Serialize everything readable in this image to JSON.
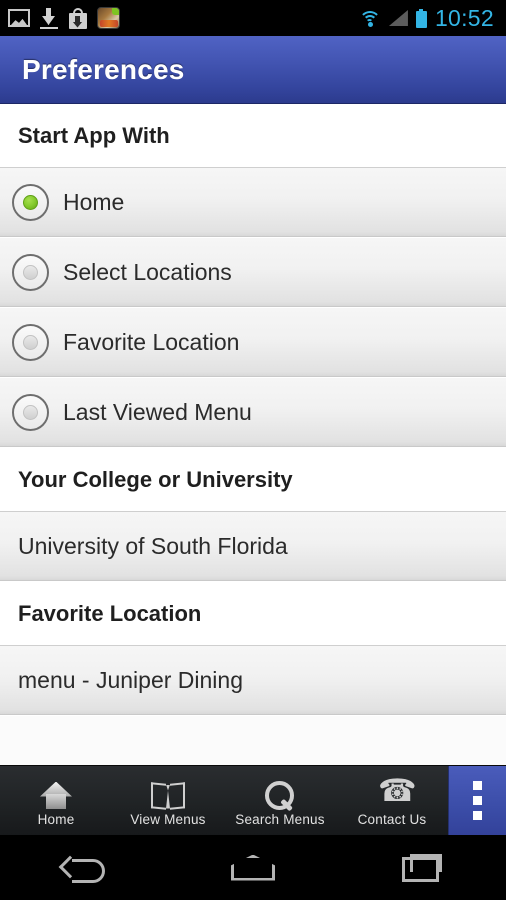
{
  "status_bar": {
    "time": "10:52",
    "notification_icons": [
      "image-icon",
      "download-icon",
      "play-store-bag-icon",
      "app-thumbnail-icon"
    ],
    "system_icons": [
      "wifi-icon",
      "cell-signal-icon",
      "battery-icon"
    ],
    "accent_color": "#33b5e5"
  },
  "title_bar": {
    "title": "Preferences",
    "background_color": "#4456b4"
  },
  "sections": [
    {
      "header": "Start App With",
      "type": "radio-group",
      "options": [
        {
          "label": "Home",
          "selected": true
        },
        {
          "label": "Select Locations",
          "selected": false
        },
        {
          "label": "Favorite Location",
          "selected": false
        },
        {
          "label": "Last Viewed Menu",
          "selected": false
        }
      ]
    },
    {
      "header": "Your College or University",
      "type": "value",
      "value": "University of South Florida"
    },
    {
      "header": "Favorite Location",
      "type": "value",
      "value": "menu - Juniper Dining"
    }
  ],
  "selected_radio_color": "#7ec52e",
  "toolbar": {
    "items": [
      {
        "label": "Home",
        "icon": "house-icon"
      },
      {
        "label": "View Menus",
        "icon": "open-book-icon"
      },
      {
        "label": "Search Menus",
        "icon": "magnifier-icon"
      },
      {
        "label": "Contact Us",
        "icon": "phone-icon"
      }
    ],
    "overflow_icon": "overflow-menu-icon",
    "overflow_color": "#3b4da8"
  },
  "nav_bar": {
    "buttons": [
      "back-icon",
      "home-icon",
      "recents-icon"
    ]
  }
}
